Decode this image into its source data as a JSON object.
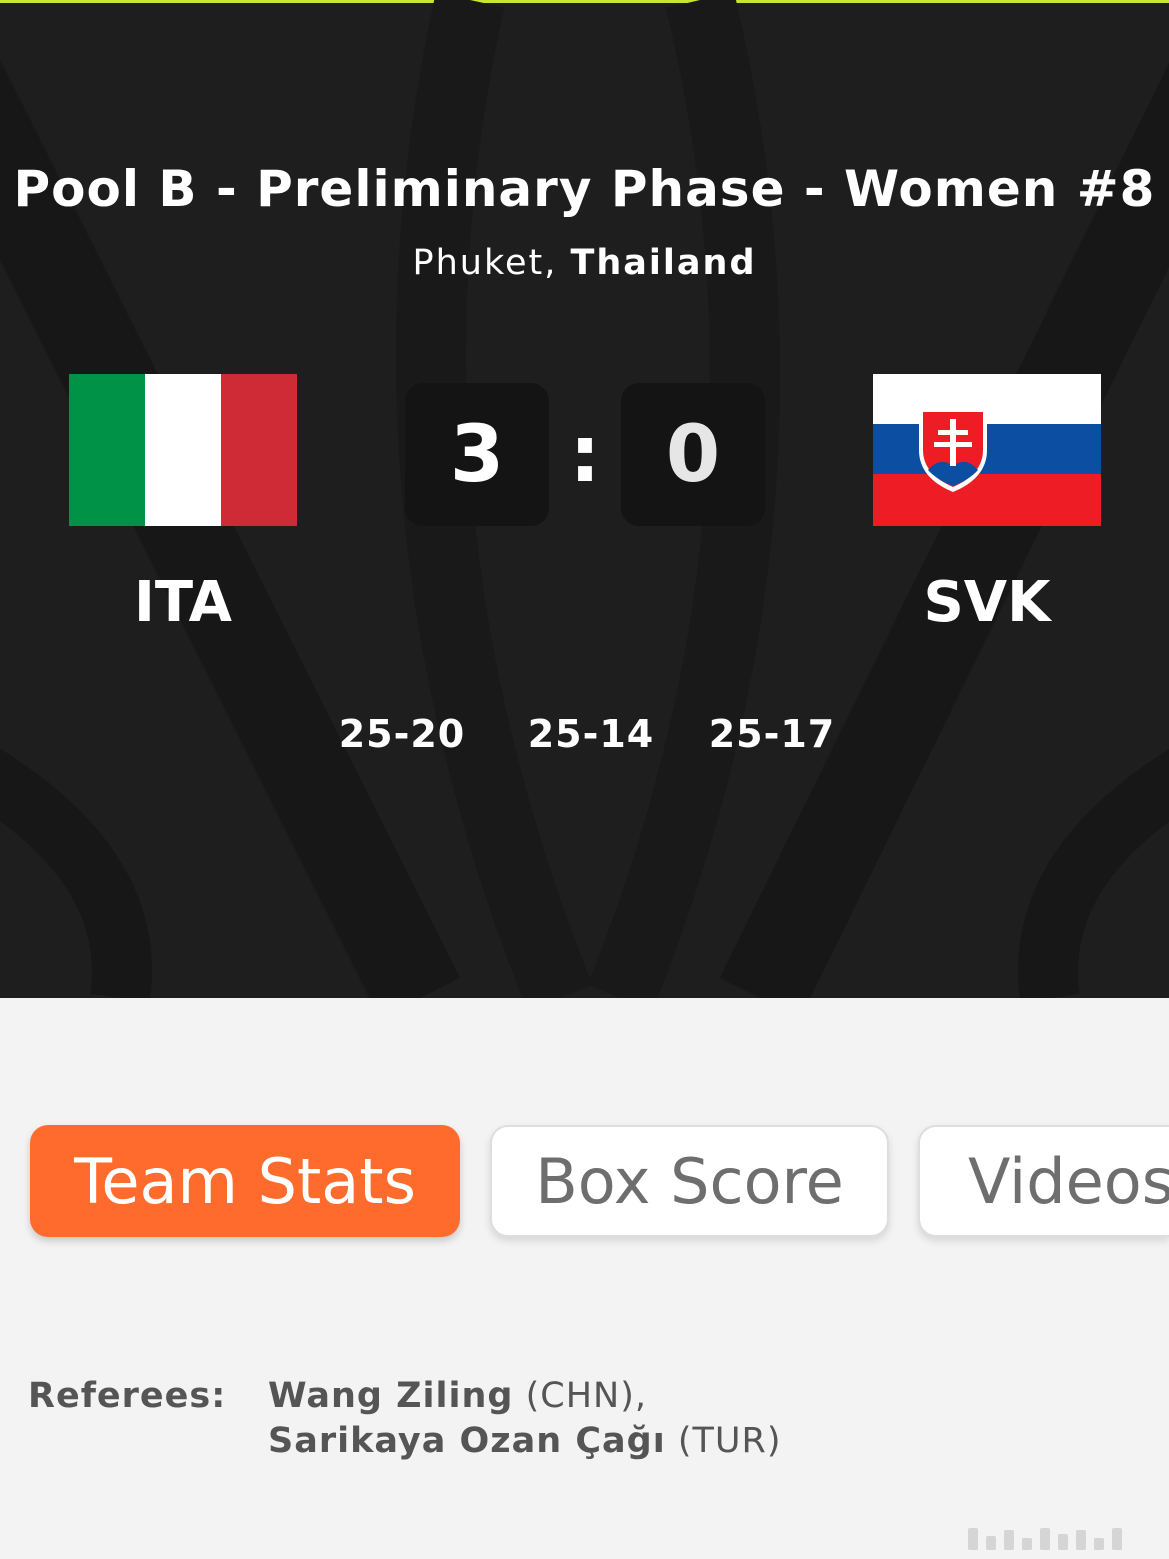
{
  "match": {
    "title": "Pool B - Preliminary Phase - Women #8",
    "city": "Phuket,",
    "country": "Thailand"
  },
  "home": {
    "code": "ITA",
    "flag": "italy-flag",
    "score": "3"
  },
  "away": {
    "code": "SVK",
    "flag": "slovakia-flag",
    "score": "0"
  },
  "score_separator": ":",
  "sets": [
    "25-20",
    "25-14",
    "25-17"
  ],
  "tabs": [
    {
      "label": "Team Stats",
      "active": true
    },
    {
      "label": "Box Score",
      "active": false
    },
    {
      "label": "Videos",
      "active": false
    }
  ],
  "referees": {
    "label": "Referees:",
    "list": [
      {
        "name": "Wang Ziling",
        "country": "(CHN),"
      },
      {
        "name": "Sarikaya Ozan Çağı",
        "country": "(TUR)"
      }
    ]
  },
  "colors": {
    "accent": "#ff6b2c",
    "hero_bg": "#1e1e1e",
    "top_line": "#c8e62e",
    "italy": [
      "#009246",
      "#ffffff",
      "#ce2b37"
    ],
    "slovakia": [
      "#ffffff",
      "#0b4ea2",
      "#ee1c25"
    ]
  }
}
